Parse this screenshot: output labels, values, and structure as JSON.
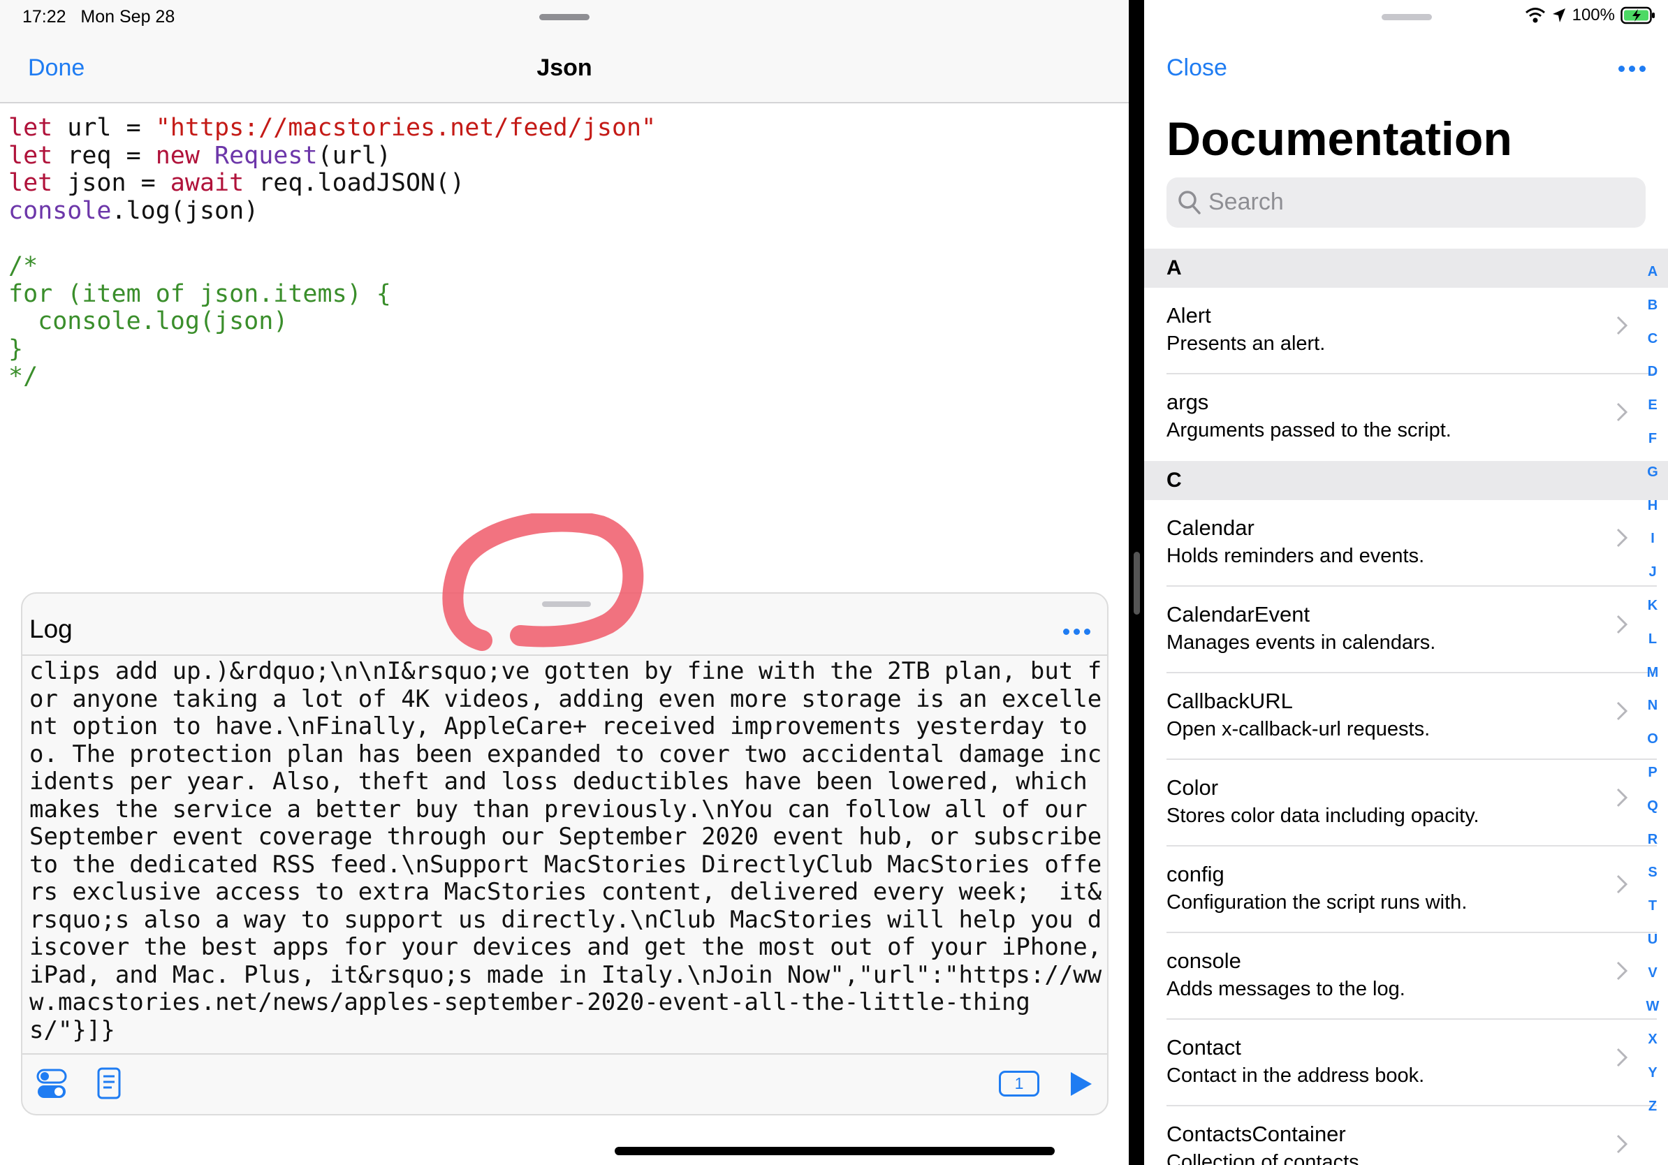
{
  "status": {
    "time": "17:22",
    "date": "Mon Sep 28",
    "battery": "100%"
  },
  "editor": {
    "done_label": "Done",
    "title": "Json",
    "code": {
      "l1_kw": "let",
      "l1_a": " url = ",
      "l1_str": "\"https://macstories.net/feed/json\"",
      "l2_kw": "let",
      "l2_a": " req = ",
      "l2_kw2": "new",
      "l2_cls": " Request",
      "l2_b": "(url)",
      "l3_kw": "let",
      "l3_a": " json = ",
      "l3_kw2": "await",
      "l3_b": " req.loadJSON()",
      "l4_cls": "console",
      "l4_b": ".log(json)",
      "comment": "/*\nfor (item of json.items) {\n  console.log(json)\n}\n*/"
    }
  },
  "log": {
    "title": "Log",
    "text": "clips add up.)&rdquo;\\n\\nI&rsquo;ve gotten by fine with the 2TB plan, but for anyone taking a lot of 4K videos, adding even more storage is an excellent option to have.\\nFinally, AppleCare+ received improvements yesterday too. The protection plan has been expanded to cover two accidental damage incidents per year. Also, theft and loss deductibles have been lowered, which makes the service a better buy than previously.\\nYou can follow all of our September event coverage through our September 2020 event hub, or subscribe to the dedicated RSS feed.\\nSupport MacStories DirectlyClub MacStories offers exclusive access to extra MacStories content, delivered every week;  it&rsquo;s also a way to support us directly.\\nClub MacStories will help you discover the best apps for your devices and get the most out of your iPhone, iPad, and Mac. Plus, it&rsquo;s made in Italy.\\nJoin Now\",\"url\":\"https://www.macstories.net/news/apples-september-2020-event-all-the-little-things/\"}]}",
    "badge_count": "1",
    "icons": [
      "toggles-icon",
      "document-icon",
      "play-icon"
    ]
  },
  "docs": {
    "close_label": "Close",
    "title": "Documentation",
    "search_placeholder": "Search",
    "sections": [
      {
        "letter": "A",
        "items": [
          {
            "name": "Alert",
            "desc": "Presents an alert."
          },
          {
            "name": "args",
            "desc": "Arguments passed to the script."
          }
        ]
      },
      {
        "letter": "C",
        "items": [
          {
            "name": "Calendar",
            "desc": "Holds reminders and events."
          },
          {
            "name": "CalendarEvent",
            "desc": "Manages events in calendars."
          },
          {
            "name": "CallbackURL",
            "desc": "Open x-callback-url requests."
          },
          {
            "name": "Color",
            "desc": "Stores color data including opacity."
          },
          {
            "name": "config",
            "desc": "Configuration the script runs with."
          },
          {
            "name": "console",
            "desc": "Adds messages to the log."
          },
          {
            "name": "Contact",
            "desc": "Contact in the address book."
          },
          {
            "name": "ContactsContainer",
            "desc": "Collection of contacts."
          }
        ]
      }
    ],
    "index_letters": [
      "A",
      "B",
      "C",
      "D",
      "E",
      "F",
      "G",
      "H",
      "I",
      "J",
      "K",
      "L",
      "M",
      "N",
      "O",
      "P",
      "Q",
      "R",
      "S",
      "T",
      "U",
      "V",
      "W",
      "X",
      "Y",
      "Z"
    ]
  },
  "colors": {
    "accent": "#1f7cf2",
    "keyword": "#b0123a",
    "string": "#c41a16",
    "class": "#6c36a9",
    "comment": "#3a8e2b",
    "annotation": "#f05a6a"
  }
}
